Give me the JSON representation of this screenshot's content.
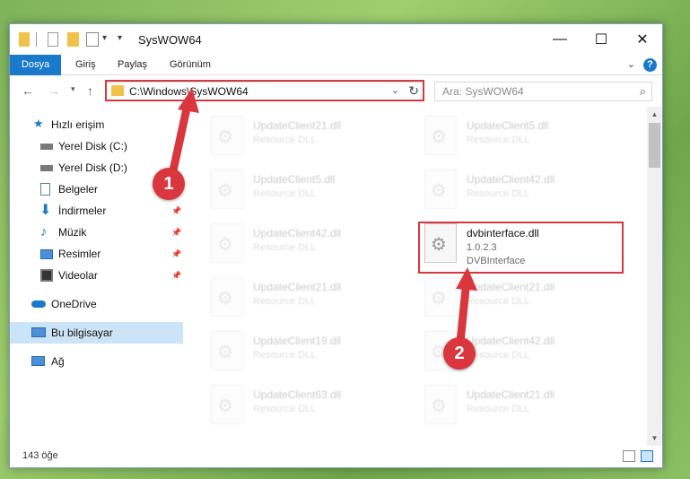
{
  "window": {
    "title": "SysWOW64",
    "controls": {
      "minimize": "—",
      "maximize": "☐",
      "close": "✕"
    }
  },
  "ribbon": {
    "tabs": [
      "Dosya",
      "Giriş",
      "Paylaş",
      "Görünüm"
    ],
    "help": "?"
  },
  "nav": {
    "address": "C:\\Windows\\SysWOW64",
    "search_placeholder": "Ara: SysWOW64"
  },
  "sidebar": {
    "items": [
      {
        "label": "Hızlı erişim",
        "icon": "star-icon",
        "pinned": false
      },
      {
        "label": "Yerel Disk (C:)",
        "icon": "drive-icon",
        "pinned": false
      },
      {
        "label": "Yerel Disk (D:)",
        "icon": "drive-icon",
        "pinned": false
      },
      {
        "label": "Belgeler",
        "icon": "document-icon",
        "pinned": false
      },
      {
        "label": "İndirmeler",
        "icon": "download-icon",
        "pinned": true
      },
      {
        "label": "Müzik",
        "icon": "music-icon",
        "pinned": true
      },
      {
        "label": "Resimler",
        "icon": "pictures-icon",
        "pinned": true
      },
      {
        "label": "Videolar",
        "icon": "video-icon",
        "pinned": true
      },
      {
        "label": "OneDrive",
        "icon": "cloud-icon",
        "pinned": false
      },
      {
        "label": "Bu bilgisayar",
        "icon": "computer-icon",
        "pinned": false,
        "selected": true
      },
      {
        "label": "Ağ",
        "icon": "network-icon",
        "pinned": false
      }
    ]
  },
  "files": {
    "left_column": [
      {
        "name": "UpdateClient21.dll",
        "meta1": "Resource DLL"
      },
      {
        "name": "UpdateClient5.dll",
        "meta1": "Resource DLL"
      },
      {
        "name": "UpdateClient42.dll",
        "meta1": "Resource DLL"
      },
      {
        "name": "UpdateClient21.dll",
        "meta1": "Resource DLL"
      },
      {
        "name": "UpdateClient19.dll",
        "meta1": "Resource DLL"
      },
      {
        "name": "UpdateClient63.dll",
        "meta1": "Resource DLL"
      }
    ],
    "right_column": [
      {
        "name": "UpdateClient5.dll",
        "meta1": "Resource DLL"
      },
      {
        "name": "UpdateClient42.dll",
        "meta1": "Resource DLL"
      },
      {
        "name": "dvbinterface.dll",
        "meta1": "1.0.2.3",
        "meta2": "DVBInterface",
        "highlighted": true
      },
      {
        "name": "UpdateClient21.dll",
        "meta1": "Resource DLL"
      },
      {
        "name": "UpdateClient42.dll",
        "meta1": "Resource DLL"
      },
      {
        "name": "UpdateClient21.dll",
        "meta1": "Resource DLL"
      }
    ]
  },
  "status": {
    "count": "143 öğe"
  },
  "callouts": [
    "1",
    "2"
  ],
  "colors": {
    "accent": "#1979ca",
    "highlight": "#d9363e",
    "selected": "#cce4f7"
  }
}
